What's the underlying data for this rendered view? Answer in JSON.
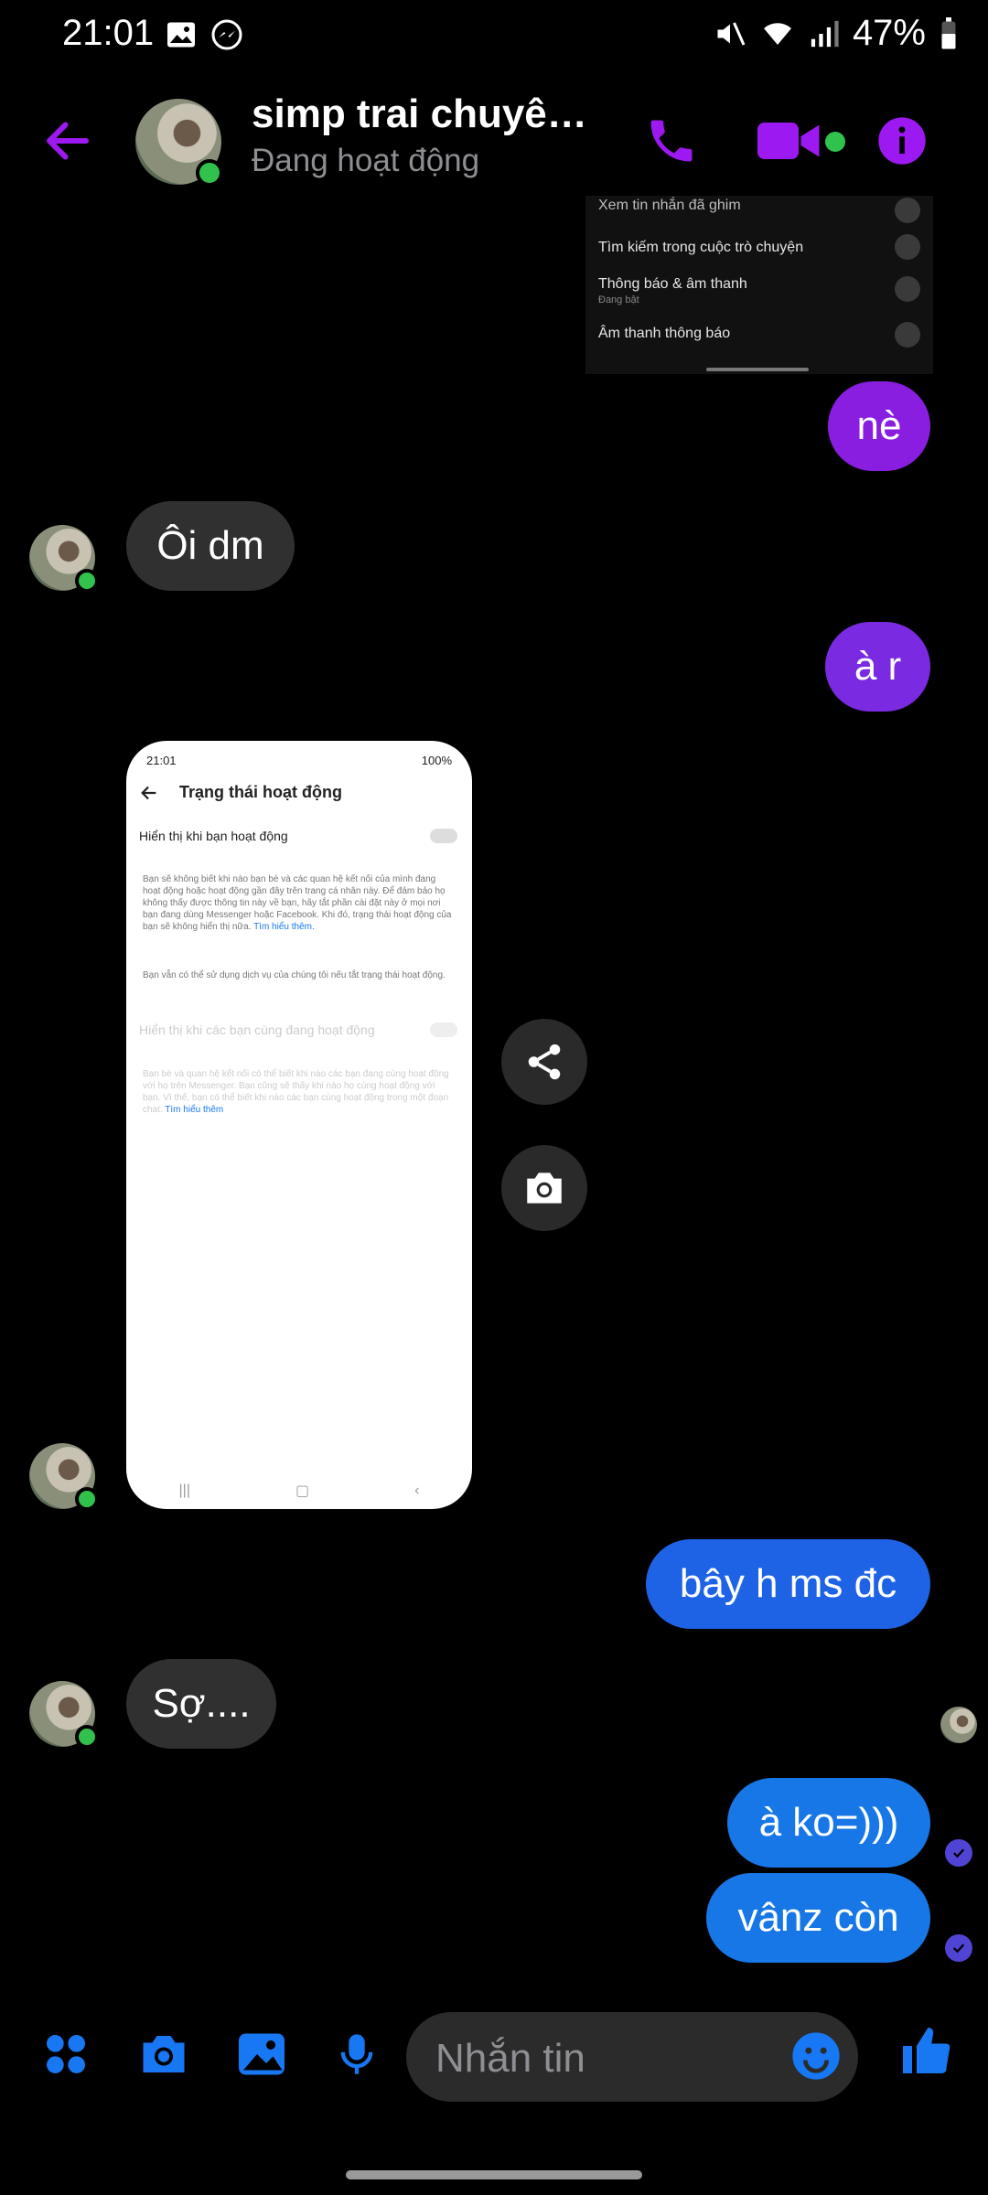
{
  "status": {
    "time": "21:01",
    "battery": "47%"
  },
  "header": {
    "title": "simp trai chuyên...",
    "subtitle": "Đang hoạt động"
  },
  "menu_screenshot": {
    "rows": [
      {
        "label": "Xem tin nhắn đã ghim",
        "sub": ""
      },
      {
        "label": "Tìm kiếm trong cuộc trò chuyện",
        "sub": ""
      },
      {
        "label": "Thông báo & âm thanh",
        "sub": "Đang bật"
      },
      {
        "label": "Âm thanh thông báo",
        "sub": ""
      }
    ]
  },
  "messages": {
    "m1": "nè",
    "m2": "Ôi dm",
    "m3": "à r",
    "m4": "bây h ms đc",
    "m5": "Sợ....",
    "m6": "à ko=)))",
    "m7": "vânz còn"
  },
  "card": {
    "time": "21:01",
    "battery": "100%",
    "title": "Trạng thái hoạt động",
    "toggle1": "Hiển thị khi bạn hoạt động",
    "para1": "Bạn sẽ không biết khi nào bạn bè và các quan hệ kết nối của mình đang hoạt động hoặc hoạt động gần đây trên trang cá nhân này. Để đảm bảo họ không thấy được thông tin này về bạn, hãy tắt phần cài đặt này ở mọi nơi bạn đang dùng Messenger hoặc Facebook. Khi đó, trạng thái hoạt động của bạn sẽ không hiển thị nữa.",
    "link1": "Tìm hiểu thêm.",
    "para2": "Bạn vẫn có thể sử dụng dịch vụ của chúng tôi nếu tắt trạng thái hoạt động.",
    "toggle2": "Hiển thị khi các bạn cùng đang hoạt động",
    "para3": "Bạn bè và quan hệ kết nối có thể biết khi nào các bạn đang cùng hoạt động với họ trên Messenger. Bạn cũng sẽ thấy khi nào họ cùng hoạt động với bạn. Vì thế, bạn có thể biết khi nào các bạn cùng hoạt động trong một đoạn chat.",
    "link2": "Tìm hiểu thêm"
  },
  "composer": {
    "placeholder": "Nhắn tin"
  },
  "colors": {
    "accent": "#8e14f0",
    "outgoing_purple": "#8a2be2",
    "outgoing_blue": "#1877f2",
    "online": "#31c24d"
  }
}
